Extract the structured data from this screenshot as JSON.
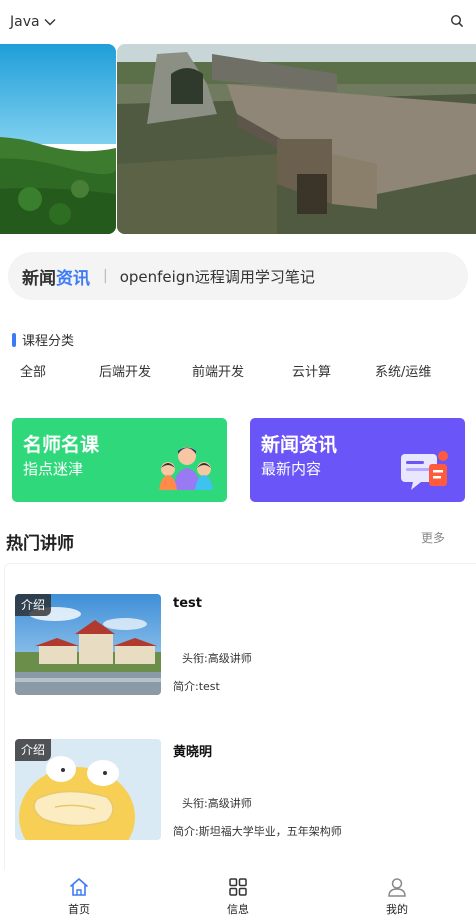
{
  "header": {
    "language": "Java",
    "language_icon": "chevron-down-icon",
    "search_icon": "search-icon"
  },
  "banner": {
    "slide_count": 5,
    "active_index": 1
  },
  "news": {
    "logo_part1": "新闻",
    "logo_part2": "资讯",
    "separator": "|",
    "headline": "openfeign远程调用学习笔记"
  },
  "category": {
    "title": "课程分类",
    "tabs": [
      "全部",
      "后端开发",
      "前端开发",
      "云计算",
      "系统/运维"
    ]
  },
  "cards": [
    {
      "title": "名师名课",
      "subtitle": "指点迷津",
      "color": "#2fd87a",
      "icon": "teachers-illustration"
    },
    {
      "title": "新闻资讯",
      "subtitle": "最新内容",
      "color": "#6955f8",
      "icon": "news-illustration"
    }
  ],
  "hot_teachers": {
    "title": "热门讲师",
    "more_label": "更多",
    "items": [
      {
        "badge": "介绍",
        "name": "test",
        "rank": "头衔:高级讲师",
        "intro": "简介:test",
        "image": "campus-photo"
      },
      {
        "badge": "介绍",
        "name": "黄晓明",
        "rank": "头衔:高级讲师",
        "intro": "简介:斯坦福大学毕业，五年架构师",
        "image": "psyduck-avatar"
      }
    ]
  },
  "tabbar": {
    "items": [
      {
        "label": "首页",
        "icon": "home-icon",
        "color": "#3d7bf6"
      },
      {
        "label": "信息",
        "icon": "grid-icon",
        "color": "#333333"
      },
      {
        "label": "我的",
        "icon": "user-icon",
        "color": "#888888"
      }
    ]
  }
}
